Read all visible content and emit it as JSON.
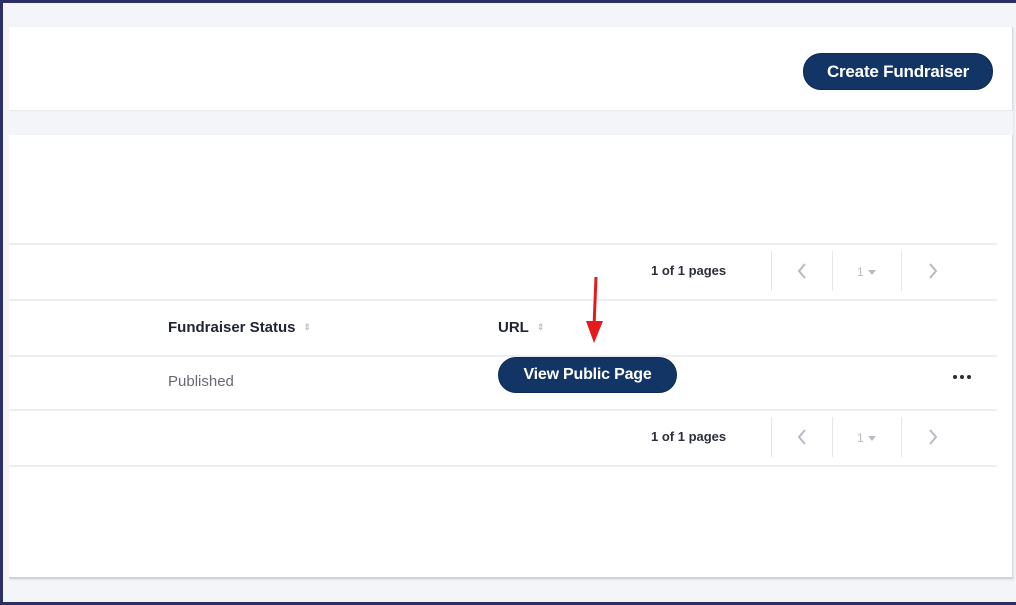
{
  "header": {
    "create_button": "Create Fundraiser"
  },
  "pager_top": {
    "label": "1 of 1 pages",
    "current_page": "1"
  },
  "pager_bottom": {
    "label": "1 of 1 pages",
    "current_page": "1"
  },
  "table": {
    "columns": [
      "Fundraiser Status",
      "URL"
    ],
    "rows": [
      {
        "status": "Published",
        "url_button": "View Public Page"
      }
    ]
  },
  "colors": {
    "primary": "#123566",
    "annotation_arrow": "#e41b1b",
    "frame_border": "#2b2f63"
  },
  "icons": {
    "prev": "chevron-left-icon",
    "next": "chevron-right-icon",
    "page_dropdown": "caret-down-icon",
    "sort": "sort-icon",
    "more": "more-options-icon",
    "annotation": "arrow-down-icon"
  }
}
